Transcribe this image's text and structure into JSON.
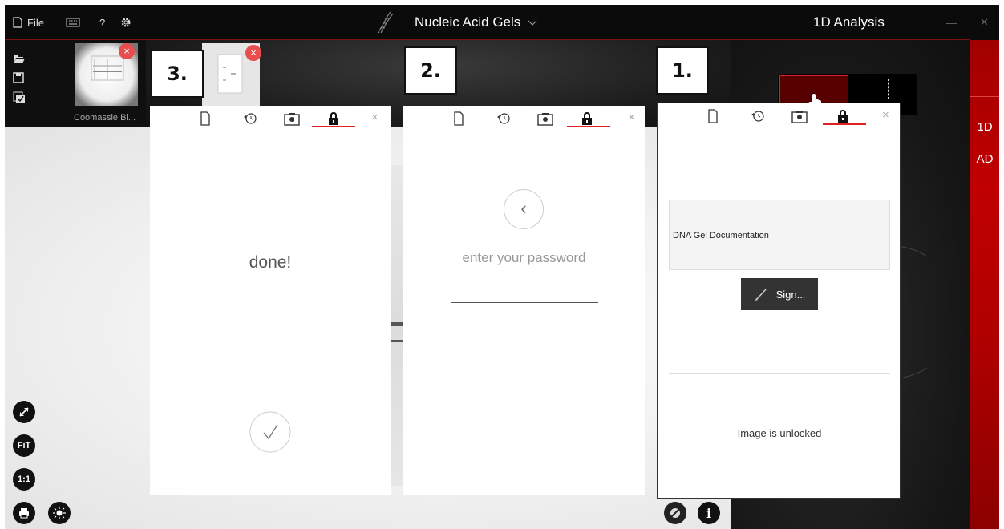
{
  "titlebar": {
    "file_label": "File",
    "help_label": "?",
    "app_title": "Nucleic Acid Gels",
    "mode_title": "1D Analysis",
    "minimize": "—",
    "close": "✕"
  },
  "thumbnails": [
    {
      "caption": "Coomassie Bl..."
    }
  ],
  "steps": [
    "3.",
    "2.",
    "1."
  ],
  "panel3": {
    "message": "done!"
  },
  "panel2": {
    "prompt": "enter your password",
    "back_glyph": "‹"
  },
  "panel1": {
    "document_name": "DNA Gel Documentation",
    "sign_label": "Sign...",
    "status": "Image is unlocked"
  },
  "sidebar": {
    "items": [
      "1D",
      "AD"
    ]
  },
  "bottom_tools": {
    "fit": "FiT",
    "one_to_one": "1:1"
  },
  "colors": {
    "accent": "#e02020",
    "sidebar": "#b00000",
    "titlebar": "#0b0b0b"
  }
}
